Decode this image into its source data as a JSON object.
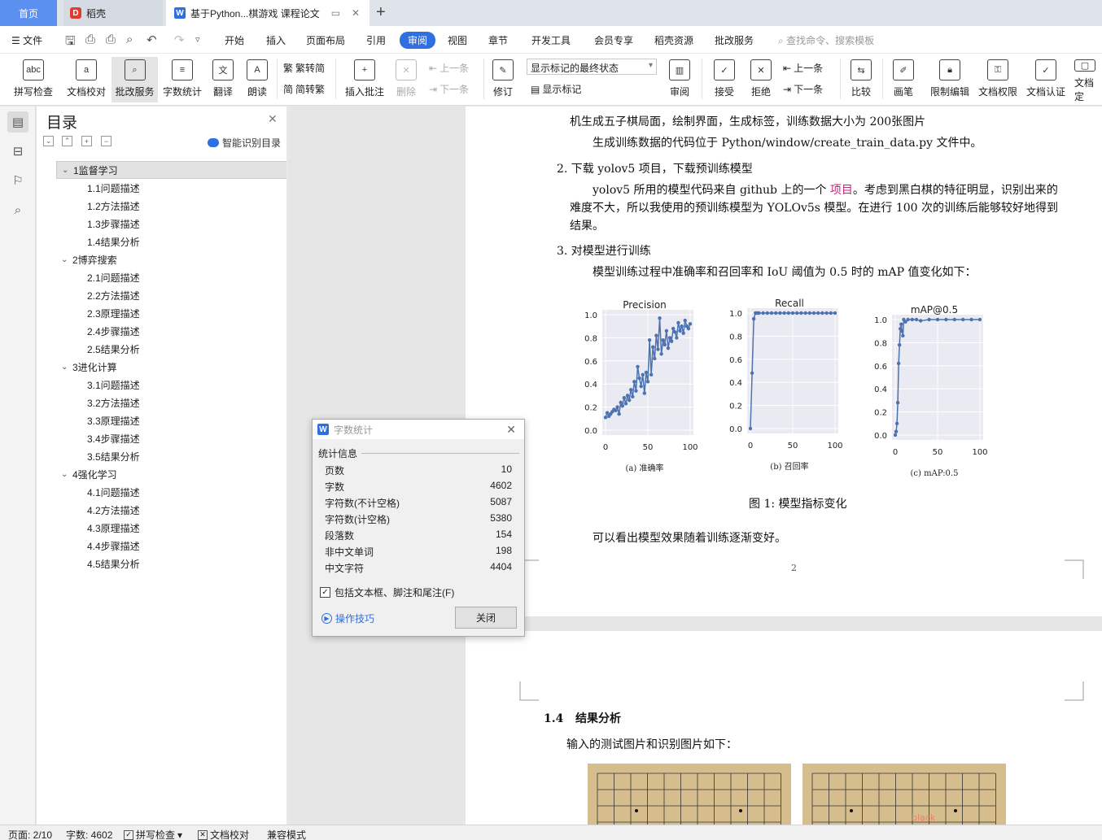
{
  "tabs": {
    "home": "首页",
    "daoke": "稻壳",
    "doc": "基于Python...棋游戏 课程论文"
  },
  "menu": [
    "开始",
    "插入",
    "页面布局",
    "引用",
    "审阅",
    "视图",
    "章节",
    "开发工具",
    "会员专享",
    "稻壳资源",
    "批改服务"
  ],
  "menu_active": "审阅",
  "file_label": "文件",
  "search_command": "查找命令、搜索模板",
  "ribbon": {
    "spellcheck": "拼写检查",
    "doc_check": "文档校对",
    "correct_service": "批改服务",
    "word_count": "字数统计",
    "translate": "翻译",
    "read_aloud": "朗读",
    "trad_to_simp": "繁转简",
    "simp_to_trad": "简转繁",
    "insert_comment": "插入批注",
    "delete": "删除",
    "prev": "上一条",
    "next": "下一条",
    "revise": "修订",
    "mark_state": "显示标记的最终状态",
    "show_marks": "显示标记",
    "review": "审阅",
    "accept": "接受",
    "reject": "拒绝",
    "prev2": "上一条",
    "next2": "下一条",
    "compare": "比较",
    "pen": "画笔",
    "restrict_edit": "限制编辑",
    "doc_rights": "文档权限",
    "doc_cert": "文档认证",
    "doc_final": "文档定"
  },
  "toc": {
    "title": "目录",
    "smart": "智能识别目录",
    "items": [
      {
        "label": "1监督学习",
        "level": 1,
        "selected": true
      },
      {
        "label": "1.1问题描述",
        "level": 2
      },
      {
        "label": "1.2方法描述",
        "level": 2
      },
      {
        "label": "1.3步骤描述",
        "level": 2
      },
      {
        "label": "1.4结果分析",
        "level": 2
      },
      {
        "label": "2博弈搜索",
        "level": 1
      },
      {
        "label": "2.1问题描述",
        "level": 2
      },
      {
        "label": "2.2方法描述",
        "level": 2
      },
      {
        "label": "2.3原理描述",
        "level": 2
      },
      {
        "label": "2.4步骤描述",
        "level": 2
      },
      {
        "label": "2.5结果分析",
        "level": 2
      },
      {
        "label": "3进化计算",
        "level": 1
      },
      {
        "label": "3.1问题描述",
        "level": 2
      },
      {
        "label": "3.2方法描述",
        "level": 2
      },
      {
        "label": "3.3原理描述",
        "level": 2
      },
      {
        "label": "3.4步骤描述",
        "level": 2
      },
      {
        "label": "3.5结果分析",
        "level": 2
      },
      {
        "label": "4强化学习",
        "level": 1
      },
      {
        "label": "4.1问题描述",
        "level": 2
      },
      {
        "label": "4.2方法描述",
        "level": 2
      },
      {
        "label": "4.3原理描述",
        "level": 2
      },
      {
        "label": "4.4步骤描述",
        "level": 2
      },
      {
        "label": "4.5结果分析",
        "level": 2
      }
    ]
  },
  "doc": {
    "line_top": "机生成五子棋局面，绘制界面，生成标签，训练数据大小为 200张图片",
    "line_code": "生成训练数据的代码位于 Python/window/create_train_data.py 文件中。",
    "step2": "2. 下载 yolov5 项目，下载预训练模型",
    "p2_a": "yolov5 所用的模型代码来自 github 上的一个 ",
    "p2_link": "项目",
    "p2_b": "。考虑到黑白棋的特征明显，识别出来的",
    "p2_c": "难度不大，所以我使用的预训练模型为 YOLOv5s 模型。在进行 100 次的训练后能够较好地得到",
    "p2_d": "结果。",
    "step3": "3. 对模型进行训练",
    "p3": "模型训练过程中准确率和召回率和 IoU 阈值为 0.5 时的 mAP 值变化如下：",
    "fig_caption": "图 1: 模型指标变化",
    "p4": "可以看出模型效果随着训练逐渐变好。",
    "page_num": "2",
    "section_num": "1.4",
    "section_title": "结果分析",
    "p5": "输入的测试图片和识别图片如下：",
    "board_label": "black"
  },
  "chart_data": [
    {
      "type": "line",
      "title": "Precision",
      "caption": "(a) 准确率",
      "xlim": [
        0,
        100
      ],
      "ylim": [
        0,
        1.0
      ],
      "xticks": [
        "0",
        "50",
        "100"
      ],
      "yticks": [
        "0.0",
        "0.2",
        "0.4",
        "0.6",
        "0.8",
        "1.0"
      ],
      "color": "#4c72b0",
      "x": [
        0,
        2,
        4,
        6,
        8,
        10,
        12,
        14,
        16,
        18,
        20,
        22,
        24,
        26,
        28,
        30,
        32,
        34,
        36,
        38,
        40,
        42,
        44,
        46,
        48,
        50,
        52,
        54,
        56,
        58,
        60,
        62,
        64,
        66,
        68,
        70,
        72,
        74,
        76,
        78,
        80,
        82,
        84,
        86,
        88,
        90,
        92,
        94,
        96,
        98,
        100
      ],
      "values": [
        0.11,
        0.15,
        0.12,
        0.14,
        0.16,
        0.18,
        0.17,
        0.2,
        0.14,
        0.24,
        0.21,
        0.28,
        0.23,
        0.3,
        0.26,
        0.35,
        0.29,
        0.42,
        0.34,
        0.55,
        0.45,
        0.38,
        0.48,
        0.32,
        0.5,
        0.42,
        0.78,
        0.48,
        0.72,
        0.62,
        0.82,
        0.7,
        0.97,
        0.66,
        0.78,
        0.74,
        0.86,
        0.71,
        0.8,
        0.77,
        0.88,
        0.85,
        0.8,
        0.93,
        0.86,
        0.9,
        0.84,
        0.95,
        0.9,
        0.88,
        0.92
      ]
    },
    {
      "type": "line",
      "title": "Recall",
      "caption": "(b) 召回率",
      "xlim": [
        0,
        100
      ],
      "ylim": [
        0,
        1.0
      ],
      "xticks": [
        "0",
        "50",
        "100"
      ],
      "yticks": [
        "0.0",
        "0.2",
        "0.4",
        "0.6",
        "0.8",
        "1.0"
      ],
      "color": "#4c72b0",
      "x": [
        0,
        2,
        4,
        6,
        8,
        10,
        15,
        20,
        25,
        30,
        35,
        40,
        45,
        50,
        55,
        60,
        65,
        70,
        75,
        80,
        85,
        90,
        95,
        100
      ],
      "values": [
        0.0,
        0.48,
        0.95,
        1.0,
        1.0,
        1.0,
        1.0,
        1.0,
        1.0,
        1.0,
        1.0,
        1.0,
        1.0,
        1.0,
        1.0,
        1.0,
        1.0,
        1.0,
        1.0,
        1.0,
        1.0,
        1.0,
        1.0,
        1.0
      ]
    },
    {
      "type": "line",
      "title": "mAP@0.5",
      "caption": "(c) mAP:0.5",
      "xlim": [
        0,
        100
      ],
      "ylim": [
        0,
        1.0
      ],
      "xticks": [
        "0",
        "50",
        "100"
      ],
      "yticks": [
        "0.0",
        "0.2",
        "0.4",
        "0.6",
        "0.8",
        "1.0"
      ],
      "color": "#4c72b0",
      "x": [
        0,
        1,
        2,
        3,
        4,
        5,
        6,
        7,
        8,
        9,
        10,
        12,
        15,
        20,
        25,
        30,
        40,
        50,
        60,
        70,
        80,
        90,
        100
      ],
      "values": [
        0.0,
        0.03,
        0.1,
        0.28,
        0.62,
        0.78,
        0.92,
        0.96,
        0.9,
        0.86,
        1.0,
        0.98,
        1.0,
        1.0,
        1.0,
        0.99,
        1.0,
        1.0,
        1.0,
        1.0,
        1.0,
        1.0,
        1.0
      ]
    }
  ],
  "dialog": {
    "title": "字数统计",
    "section": "统计信息",
    "stats": [
      {
        "label": "页数",
        "value": "10"
      },
      {
        "label": "字数",
        "value": "4602"
      },
      {
        "label": "字符数(不计空格)",
        "value": "5087"
      },
      {
        "label": "字符数(计空格)",
        "value": "5380"
      },
      {
        "label": "段落数",
        "value": "154"
      },
      {
        "label": "非中文单词",
        "value": "198"
      },
      {
        "label": "中文字符",
        "value": "4404"
      }
    ],
    "include_label": "包括文本框、脚注和尾注(F)",
    "tips": "操作技巧",
    "close": "关闭"
  },
  "status": {
    "page": "页面: 2/10",
    "words": "字数: 4602",
    "spell": "拼写检查",
    "proof": "文档校对",
    "compat": "兼容模式"
  }
}
